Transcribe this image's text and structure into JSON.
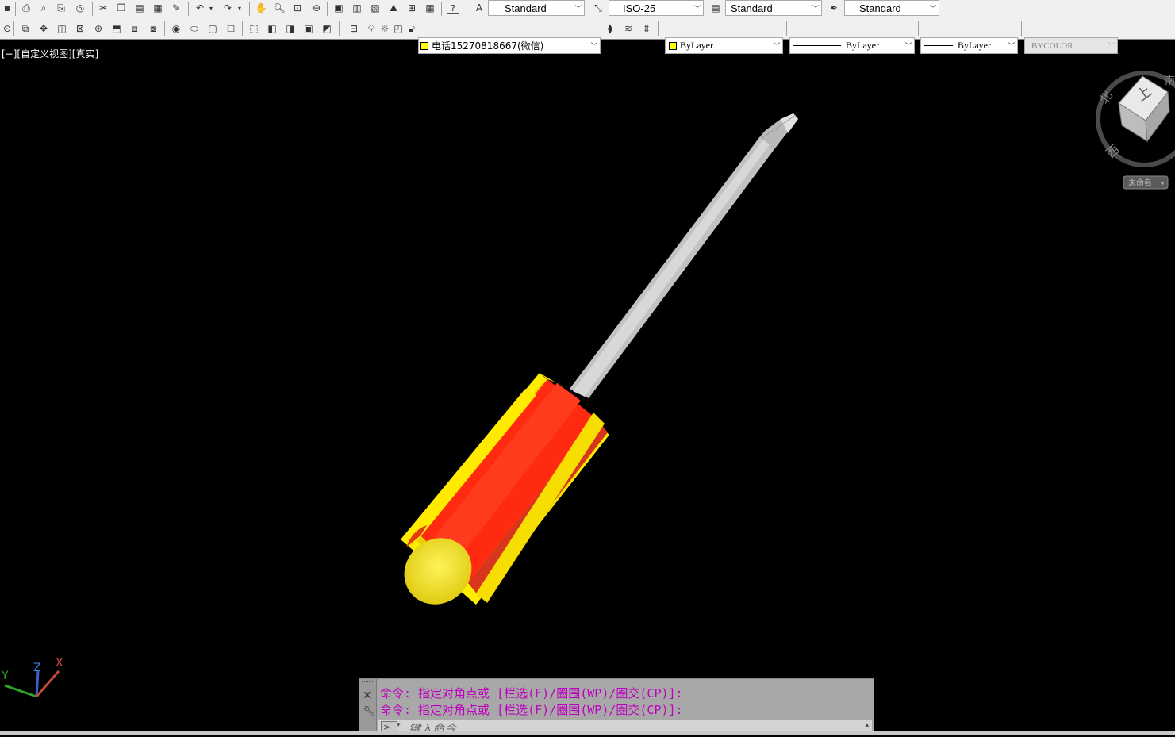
{
  "toolbar1": {
    "text_style": "Standard",
    "dim_style": "ISO-25",
    "table_style": "Standard",
    "mleader_style": "Standard"
  },
  "toolbar2": {
    "layer_name": "电话15270818667(微信)",
    "color": "ByLayer",
    "linetype": "ByLayer",
    "lineweight": "ByLayer",
    "plotstyle": "BYCOLOR"
  },
  "viewport": {
    "label": "[−][自定义视图][真实]"
  },
  "viewcube": {
    "top_face": "上",
    "north": "北",
    "west": "西",
    "south_small": "南",
    "wcs_menu": "未命名"
  },
  "ucs": {
    "x": "X",
    "y": "Y",
    "z": "Z"
  },
  "command": {
    "history": [
      "命令: 指定对角点或 [栏选(F)/圈围(WP)/圈交(CP)]:",
      "命令: 指定对角点或 [栏选(F)/圈围(WP)/圈交(CP)]:"
    ],
    "placeholder": "键入命令"
  },
  "colors": {
    "handle_red": "#ff2a10",
    "handle_yellow": "#ffee00",
    "shaft_gray": "#c8c8c8",
    "command_text": "#c000c0"
  }
}
